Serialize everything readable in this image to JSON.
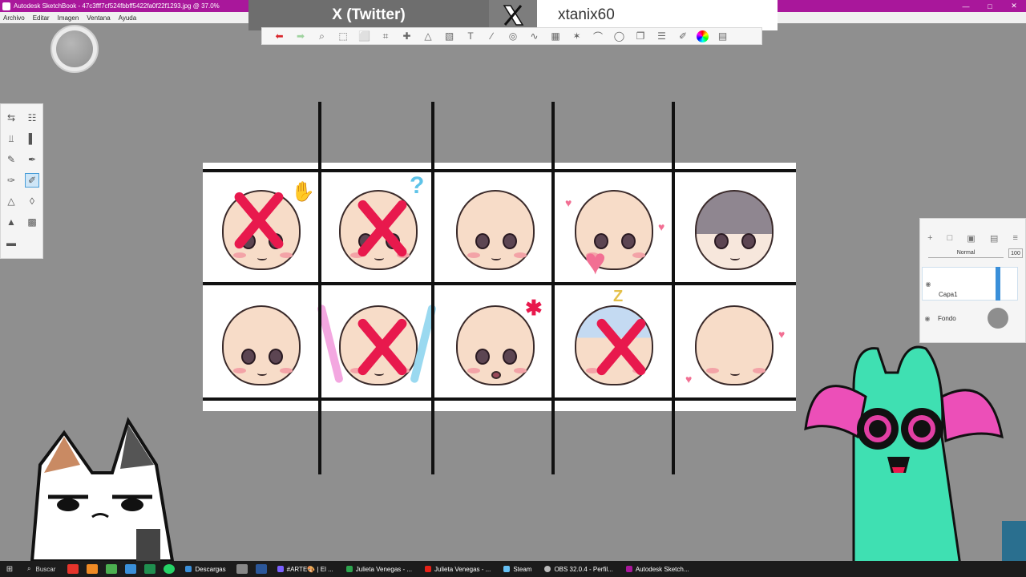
{
  "window": {
    "title": "Autodesk SketchBook - 47c3fff7cf524fbbff5422fa0f22f1293.jpg @ 37.0%",
    "controls": {
      "minimize": "—",
      "maximize": "□",
      "close": "✕"
    }
  },
  "menu": {
    "items": [
      "Archivo",
      "Editar",
      "Imagen",
      "Ventana",
      "Ayuda"
    ]
  },
  "overlay": {
    "label": "X (Twitter)",
    "handle": "xtanix60"
  },
  "toolbar": {
    "tools": [
      "undo-icon",
      "redo-icon",
      "zoom-icon",
      "select-icon",
      "lasso-icon",
      "crop-icon",
      "move-icon",
      "perspective-icon",
      "fill-icon",
      "text-icon",
      "ruler-icon",
      "ellipse-icon",
      "curve-icon",
      "grid-icon",
      "symmetry-icon",
      "stroke-icon",
      "shape-icon",
      "copy-icon",
      "brush-library-icon",
      "color-wheel-icon",
      "layers-icon"
    ]
  },
  "layers": {
    "blend_mode": "Normal",
    "opacity": "100",
    "items": [
      {
        "name": "Capa1",
        "selected": true
      },
      {
        "name": "Fondo",
        "selected": false
      }
    ]
  },
  "taskbar": {
    "search_label": "Buscar",
    "items": [
      {
        "label": "Descargas",
        "color": "#3a8fd9"
      },
      {
        "label": "#ARTE🎨 | El ...",
        "color": "#7b61ff"
      },
      {
        "label": "Julieta Venegas - ...",
        "color": "#2da44e"
      },
      {
        "label": "Julieta Venegas - ...",
        "color": "#e62117"
      },
      {
        "label": "Steam",
        "color": "#1b2838"
      },
      {
        "label": "OBS 32.0.4 - Perfil...",
        "color": "#555555"
      },
      {
        "label": "Autodesk Sketch...",
        "color": "#a9179b"
      }
    ]
  },
  "colors": {
    "titlebar": "#a9179b",
    "canvas_bg": "#8f8f8f",
    "redx": "#e8194d"
  }
}
